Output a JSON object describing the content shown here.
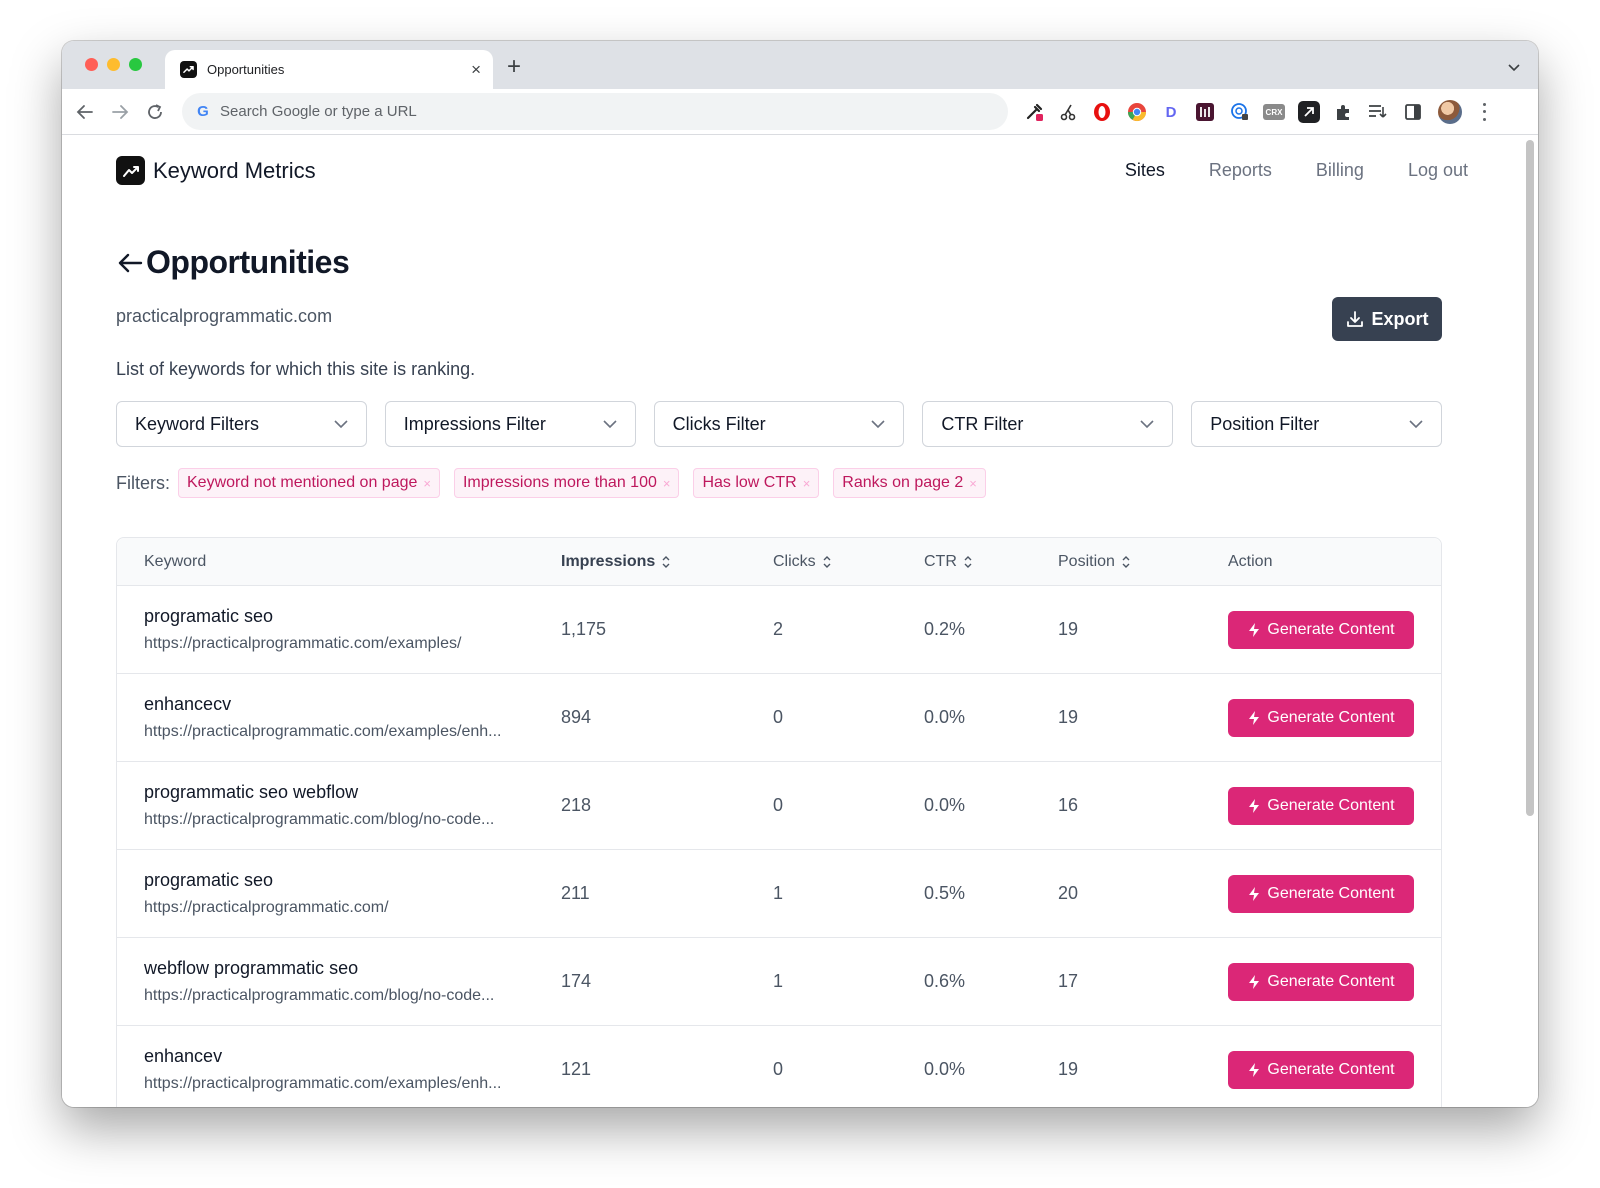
{
  "browser": {
    "tab_title": "Opportunities",
    "omnibox_placeholder": "Search Google or type a URL",
    "extensions": [
      "eyedropper-icon",
      "scissors-icon",
      "opera-icon",
      "chrome-icon",
      "d-icon",
      "bracket-icon",
      "globe-lock-icon",
      "crx-icon",
      "arrow-box-icon",
      "puzzle-icon",
      "reading-list-icon",
      "sidepanel-icon"
    ],
    "crx_label": "CRX",
    "d_label": "D"
  },
  "app": {
    "name": "Keyword Metrics",
    "nav": [
      "Sites",
      "Reports",
      "Billing",
      "Log out"
    ],
    "active_nav": "Sites"
  },
  "page": {
    "title": "Opportunities",
    "domain": "practicalprogrammatic.com",
    "description": "List of keywords for which this site is ranking.",
    "export_label": "Export"
  },
  "filters": [
    "Keyword Filters",
    "Impressions Filter",
    "Clicks Filter",
    "CTR Filter",
    "Position Filter"
  ],
  "active_filters": {
    "label": "Filters:",
    "chips": [
      "Keyword not mentioned on page",
      "Impressions more than 100",
      "Has low CTR",
      "Ranks on page 2"
    ],
    "remove_glyph": "×"
  },
  "table": {
    "headers": {
      "keyword": "Keyword",
      "impressions": "Impressions",
      "clicks": "Clicks",
      "ctr": "CTR",
      "position": "Position",
      "action": "Action"
    },
    "action_label": "Generate Content",
    "rows": [
      {
        "keyword": "programatic seo",
        "url": "https://practicalprogrammatic.com/examples/",
        "impressions": "1,175",
        "clicks": "2",
        "ctr": "0.2%",
        "position": "19"
      },
      {
        "keyword": "enhancecv",
        "url": "https://practicalprogrammatic.com/examples/enh...",
        "impressions": "894",
        "clicks": "0",
        "ctr": "0.0%",
        "position": "19"
      },
      {
        "keyword": "programmatic seo webflow",
        "url": "https://practicalprogrammatic.com/blog/no-code...",
        "impressions": "218",
        "clicks": "0",
        "ctr": "0.0%",
        "position": "16"
      },
      {
        "keyword": "programatic seo",
        "url": "https://practicalprogrammatic.com/",
        "impressions": "211",
        "clicks": "1",
        "ctr": "0.5%",
        "position": "20"
      },
      {
        "keyword": "webflow programmatic seo",
        "url": "https://practicalprogrammatic.com/blog/no-code...",
        "impressions": "174",
        "clicks": "1",
        "ctr": "0.6%",
        "position": "17"
      },
      {
        "keyword": "enhancev",
        "url": "https://practicalprogrammatic.com/examples/enh...",
        "impressions": "121",
        "clicks": "0",
        "ctr": "0.0%",
        "position": "19"
      }
    ]
  },
  "colors": {
    "accent": "#db2777",
    "chip_text": "#be185d",
    "chip_bg": "#fdf2f8",
    "export_bg": "#374151"
  }
}
